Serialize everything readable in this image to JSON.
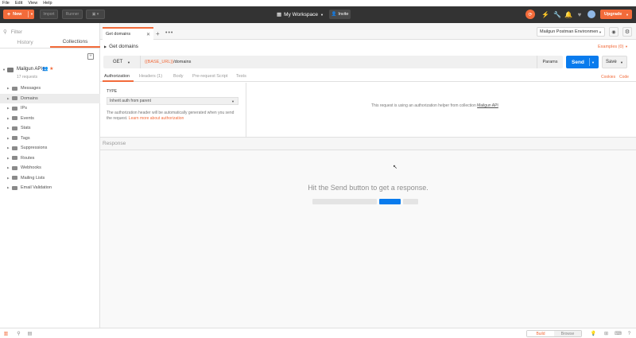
{
  "menu": [
    "File",
    "Edit",
    "View",
    "Help"
  ],
  "toolbar": {
    "new_label": "New",
    "import_label": "Import",
    "runner_label": "Runner",
    "workspace_label": "My Workspace",
    "invite_label": "Invite",
    "upgrade_label": "Upgrade"
  },
  "sidebar": {
    "filter_placeholder": "Filter",
    "tabs": [
      "History",
      "Collections"
    ],
    "collection": {
      "name": "Mailgun API",
      "meta": "17 requests"
    },
    "folders": [
      "Messages",
      "Domains",
      "IPs",
      "Events",
      "Stats",
      "Tags",
      "Suppressions",
      "Routes",
      "Webhooks",
      "Mailing Lists",
      "Email Validation"
    ],
    "selected_folder": "Domains"
  },
  "request": {
    "tab_label": "Get domains",
    "title": "Get domains",
    "examples_label": "Examples (0)",
    "method": "GET",
    "url_var": "{{BASE_URL}}",
    "url_path": "/domains",
    "params_label": "Params",
    "send_label": "Send",
    "save_label": "Save",
    "environment": "Mailgun Postman Environmen",
    "subtabs": [
      "Authorization",
      "Headers (1)",
      "Body",
      "Pre-request Script",
      "Tests"
    ],
    "cookies_label": "Cookies",
    "code_label": "Code"
  },
  "auth": {
    "type_label": "TYPE",
    "type_value": "Inherit auth from parent",
    "desc": "The authorization header will be automatically generated when you send the request.",
    "learn_more": "Learn more about authorization",
    "helper_text": "This request is using an authorization helper from collection",
    "helper_link": "Mailgun API"
  },
  "response": {
    "label": "Response",
    "hint": "Hit the Send button to get a response."
  },
  "statusbar": {
    "build_label": "Build",
    "browse_label": "Browse"
  },
  "colors": {
    "accent": "#f26b3a",
    "primary": "#097bed",
    "topbar": "#333333"
  }
}
